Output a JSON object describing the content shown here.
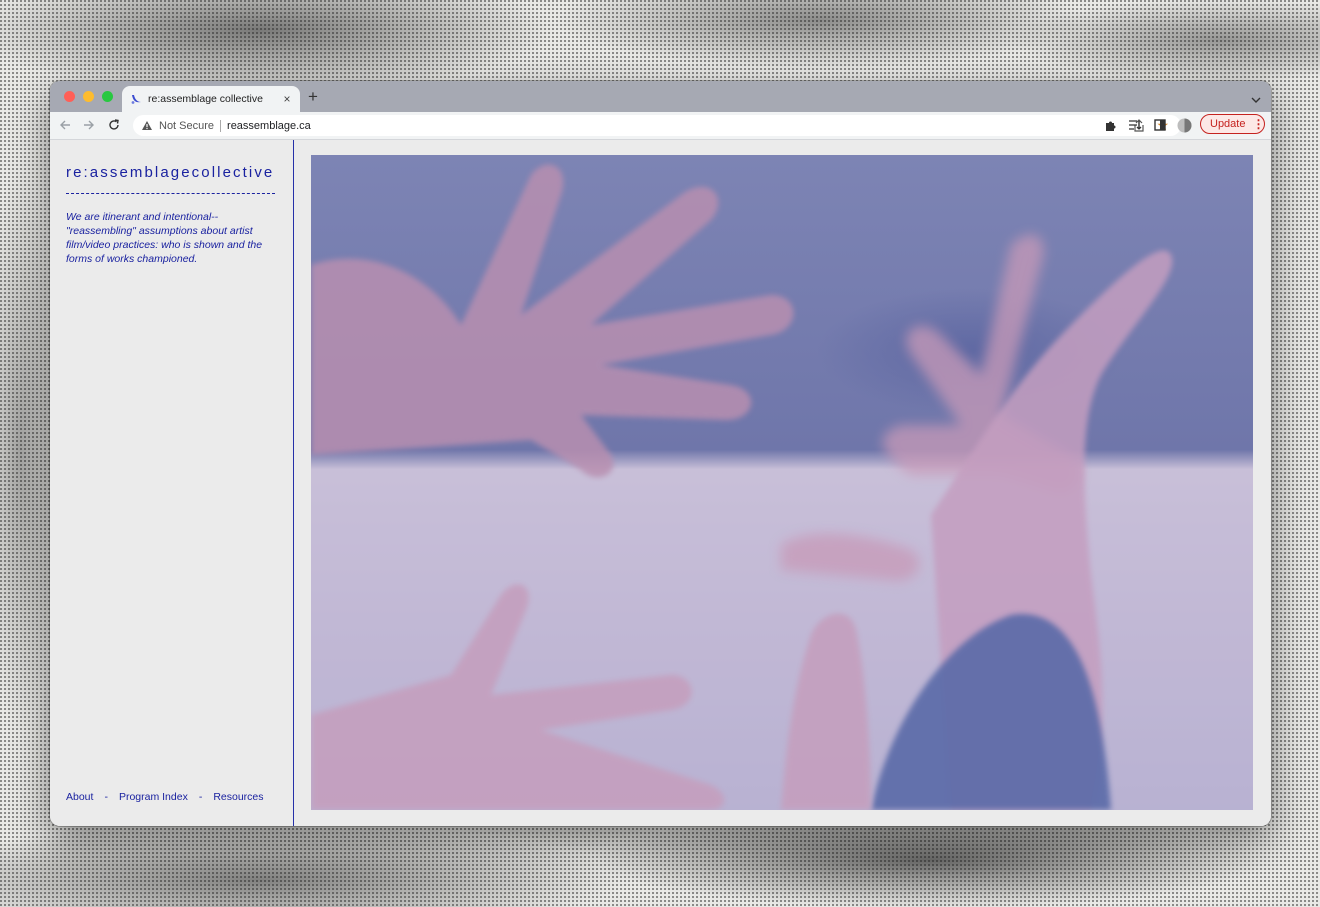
{
  "browser": {
    "tab_title": "re:assemblage collective",
    "tab_close": "×",
    "new_tab": "+",
    "security_label": "Not Secure",
    "url": "reassemblage.ca",
    "update_label": "Update",
    "update_menu": "⋮"
  },
  "site": {
    "logo": "re:assemblagecollective",
    "tagline": "We are itinerant and intentional-- \"reassembling\" assumptions about artist film/video practices: who is shown and the forms of works championed.",
    "nav": {
      "about": "About",
      "program_index": "Program Index",
      "resources": "Resources",
      "separator": "-"
    },
    "accent_color": "#1a22a0"
  },
  "colors": {
    "traffic_red": "#ff5f57",
    "traffic_yellow": "#febc2e",
    "traffic_green": "#28c840",
    "update_red": "#c5221f",
    "bookmark_star": "#d7892a"
  }
}
